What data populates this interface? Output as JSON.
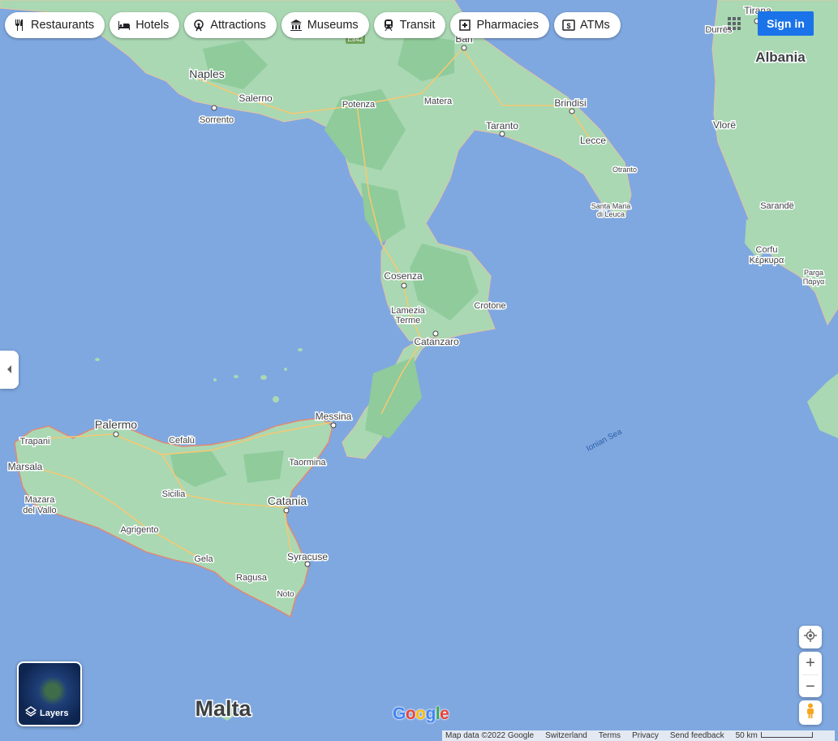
{
  "chips": [
    {
      "label": "Restaurants",
      "icon": "fork-knife-icon"
    },
    {
      "label": "Hotels",
      "icon": "bed-icon"
    },
    {
      "label": "Attractions",
      "icon": "ferris-wheel-icon"
    },
    {
      "label": "Museums",
      "icon": "museum-icon"
    },
    {
      "label": "Transit",
      "icon": "train-icon"
    },
    {
      "label": "Pharmacies",
      "icon": "pharmacy-icon"
    },
    {
      "label": "ATMs",
      "icon": "atm-icon"
    }
  ],
  "signin_label": "Sign in",
  "layers_label": "Layers",
  "zoom": {
    "in": "+",
    "out": "−"
  },
  "google_logo": "Google",
  "footer": {
    "map_data": "Map data ©2022 Google",
    "region": "Switzerland",
    "terms": "Terms",
    "privacy": "Privacy",
    "feedback": "Send feedback",
    "scale": "50 km"
  },
  "places": {
    "country_albania": "Albania",
    "country_malta": "Malta",
    "sea_ionian": "Ionian Sea",
    "tirana": "Tirana",
    "durres": "Durrës",
    "bari": "Bari",
    "naples": "Naples",
    "salerno": "Salerno",
    "sorrento": "Sorrento",
    "potenza": "Potenza",
    "matera": "Matera",
    "brindisi": "Brindisi",
    "taranto": "Taranto",
    "lecce": "Lecce",
    "otranto": "Otranto",
    "santa_maria_1": "Santa Maria",
    "santa_maria_2": "di Leuca",
    "vlore": "Vlorë",
    "sarande": "Sarandë",
    "corfu": "Corfu",
    "corfu_gr": "Κέρκυρα",
    "parga": "Parga",
    "parga_gr": "Πάργα",
    "cosenza": "Cosenza",
    "crotone": "Crotone",
    "lamezia_1": "Lamezia",
    "lamezia_2": "Terme",
    "catanzaro": "Catanzaro",
    "messina": "Messina",
    "palermo": "Palermo",
    "trapani": "Trapani",
    "cefalu": "Cefalù",
    "marsala": "Marsala",
    "mazara_1": "Mazara",
    "mazara_2": "del Vallo",
    "sicilia": "Sicilia",
    "taormina": "Taormina",
    "catania": "Catania",
    "agrigento": "Agrigento",
    "gela": "Gela",
    "syracuse": "Syracuse",
    "ragusa": "Ragusa",
    "noto": "Noto",
    "e842": "E842"
  },
  "colors": {
    "sea": "#7fa8e0",
    "land": "#a9d8b3",
    "forest": "#8fcb9b",
    "coast": "#e8856f",
    "road": "#f6c873",
    "signin": "#1a73e8"
  }
}
